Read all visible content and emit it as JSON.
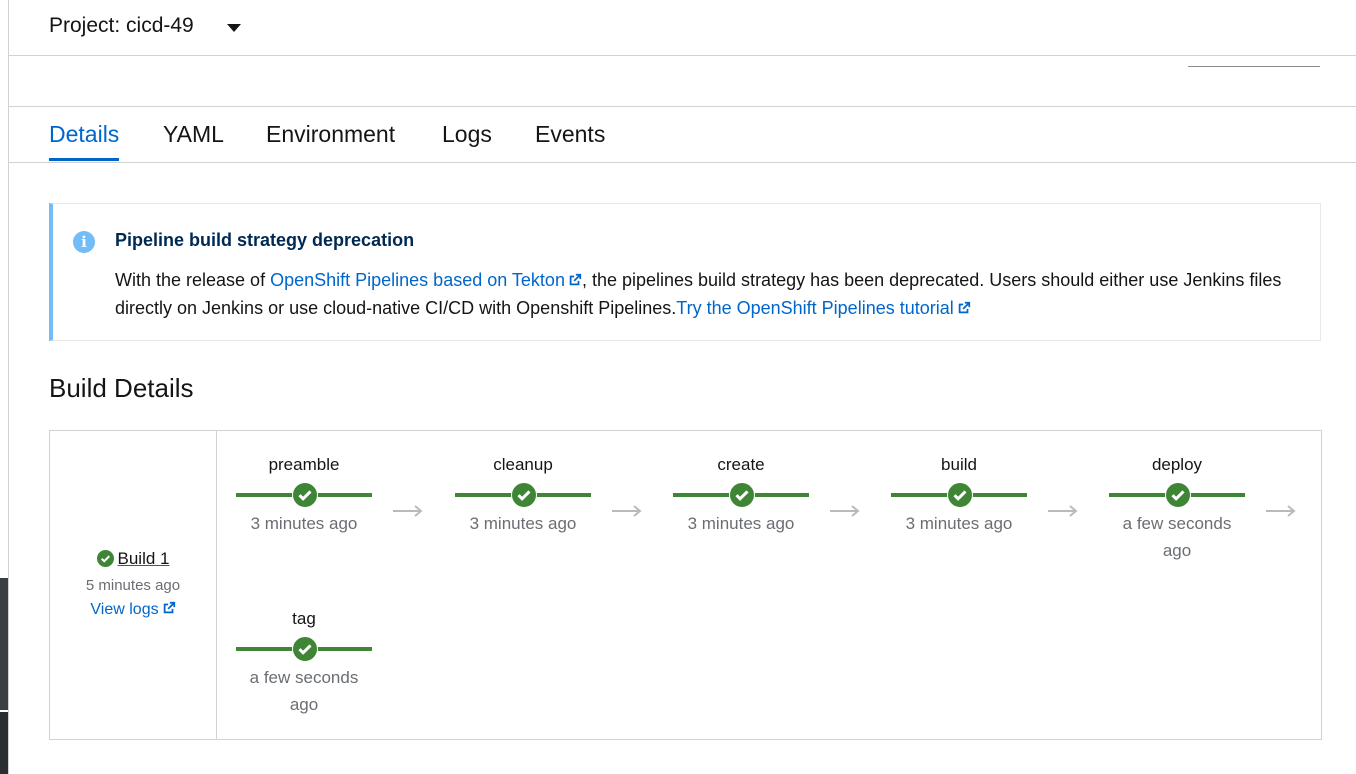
{
  "project": {
    "label": "Project: cicd-49"
  },
  "tabs": [
    {
      "label": "Details",
      "active": true
    },
    {
      "label": "YAML"
    },
    {
      "label": "Environment"
    },
    {
      "label": "Logs"
    },
    {
      "label": "Events"
    }
  ],
  "alert": {
    "title": "Pipeline build strategy deprecation",
    "text_1": "With the release of ",
    "link_1": "OpenShift Pipelines based on Tekton",
    "text_2": ", the pipelines build strategy has been deprecated. Users should either use Jenkins files directly on Jenkins or use cloud-native CI/CD with Openshift Pipelines.",
    "link_2": "Try the OpenShift Pipelines tutorial"
  },
  "build_details": {
    "title": "Build Details",
    "build": {
      "name": "Build 1",
      "time": "5 minutes ago",
      "view_logs": "View logs"
    },
    "stages": [
      {
        "name": "preamble",
        "time": "3 minutes ago"
      },
      {
        "name": "cleanup",
        "time": "3 minutes ago"
      },
      {
        "name": "create",
        "time": "3 minutes ago"
      },
      {
        "name": "build",
        "time": "3 minutes ago"
      },
      {
        "name": "deploy",
        "time": "a few seconds ago"
      },
      {
        "name": "tag",
        "time": "a few seconds ago"
      }
    ]
  },
  "colors": {
    "accent": "#0066cc",
    "success": "#3e8635",
    "info": "#73bcf7"
  }
}
